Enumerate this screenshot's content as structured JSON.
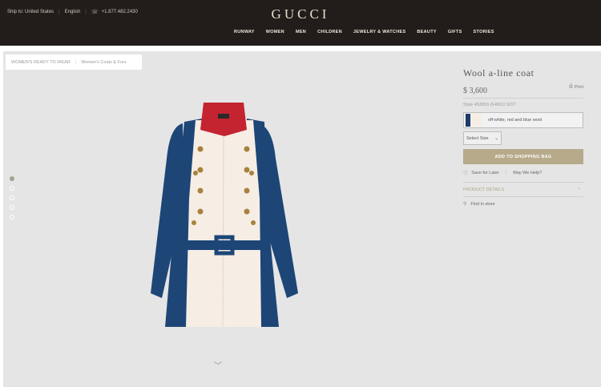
{
  "header": {
    "ship_to": "Ship to: United States",
    "language": "English",
    "phone": "+1.877.482.2430",
    "brand": "GUCCI",
    "nav": [
      "RUNWAY",
      "WOMEN",
      "MEN",
      "CHILDREN",
      "JEWELRY & WATCHES",
      "BEAUTY",
      "GIFTS",
      "STORIES"
    ]
  },
  "breadcrumb": [
    "WOMEN'S READY TO WEAR",
    "Women's Coats & Furs"
  ],
  "gallery": {
    "dot_count": 5,
    "active_index": 0
  },
  "product": {
    "title": "Wool a-line coat",
    "price": "$ 3,600",
    "print_label": "Print",
    "style": "Style 453953 ZHW10 9227",
    "color_label": "off-white, red and blue wool",
    "size_select": "Select Size",
    "add_to_bag": "ADD TO SHOPPING BAG",
    "save_for_later": "Save for Later",
    "may_we_help": "May We Help?",
    "product_details": "PRODUCT DETAILS",
    "find_in_store": "Find in store"
  },
  "colors": {
    "topbar": "#221d1a",
    "add_button": "#b7aa8a",
    "coat_blue": "#1d4677",
    "coat_cream": "#f6ede5",
    "collar_red": "#c42330"
  }
}
